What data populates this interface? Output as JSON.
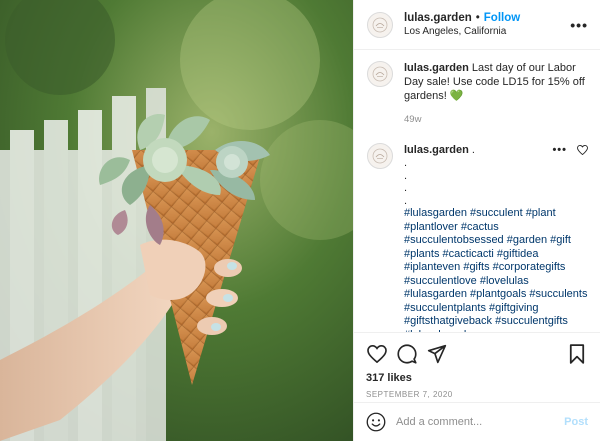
{
  "post": {
    "username": "lulas.garden",
    "follow_label": "Follow",
    "location": "Los Angeles, California",
    "caption": {
      "username": "lulas.garden",
      "text": "Last day of our Labor Day sale! Use code LD15 for 15% off gardens! 💚",
      "age": "49w"
    },
    "comment": {
      "username": "lulas.garden",
      "dot_after_name": ".",
      "dots": [
        ".",
        ".",
        ".",
        "."
      ],
      "hashtags": "#lulasgarden #succulent #plant #plantlover #cactus #succulentobsessed #garden #gift #plants #cacticacti #giftidea #iplanteven #gifts #corporategifts #succulentlove #lovelulas #lulasgarden #plantgoals #succulents #succulentplants #giftgiving #giftsthatgiveback #succulentgifts #labordaysale"
    },
    "likes": "317 likes",
    "date": "SEPTEMBER 7, 2020",
    "add_comment_placeholder": "Add a comment...",
    "post_button": "Post"
  },
  "icons": {
    "more": "more-options-icon",
    "like": "heart-icon",
    "comment": "comment-icon",
    "share": "share-icon",
    "save": "bookmark-icon",
    "emoji": "emoji-icon",
    "avatar": "lulas-garden-avatar"
  },
  "colors": {
    "follow": "#0095f6",
    "hashtag": "#00376b",
    "muted": "#8e8e8e",
    "post_disabled": "#b2dffc"
  }
}
